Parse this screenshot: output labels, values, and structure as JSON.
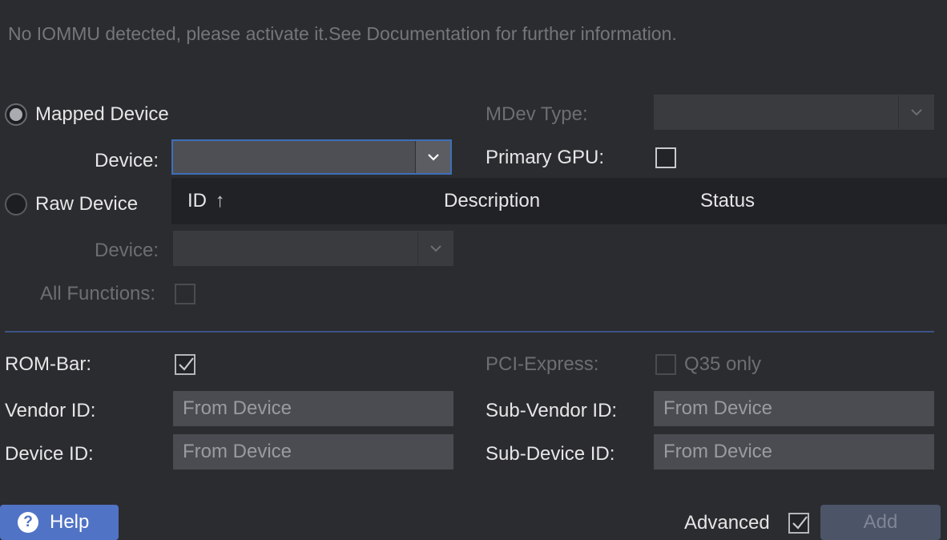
{
  "warning": "No IOMMU detected, please activate it.See Documentation for further information.",
  "mapped": {
    "radio_label": "Mapped Device",
    "device_label": "Device:",
    "device_value": ""
  },
  "raw": {
    "radio_label": "Raw Device",
    "device_label": "Device:",
    "all_functions_label": "All Functions:"
  },
  "mdev": {
    "type_label": "MDev Type:",
    "primary_gpu_label": "Primary GPU:"
  },
  "grid": {
    "columns": [
      "ID",
      "Description",
      "Status"
    ],
    "sort_glyph": "↑"
  },
  "advanced": {
    "rombar_label": "ROM-Bar:",
    "pcie_label": "PCI-Express:",
    "pcie_note": "Q35 only",
    "vendor_label": "Vendor ID:",
    "vendor_placeholder": "From Device",
    "device_id_label": "Device ID:",
    "device_id_placeholder": "From Device",
    "subvendor_label": "Sub-Vendor ID:",
    "subvendor_placeholder": "From Device",
    "subdevice_label": "Sub-Device ID:",
    "subdevice_placeholder": "From Device"
  },
  "footer": {
    "help_label": "Help",
    "help_icon": "question-circle-icon",
    "advanced_label": "Advanced",
    "add_label": "Add"
  },
  "colors": {
    "background": "#2b2c30",
    "accent": "#5173c6",
    "focus_border": "#3d6fb8",
    "divider": "#3d5384"
  }
}
